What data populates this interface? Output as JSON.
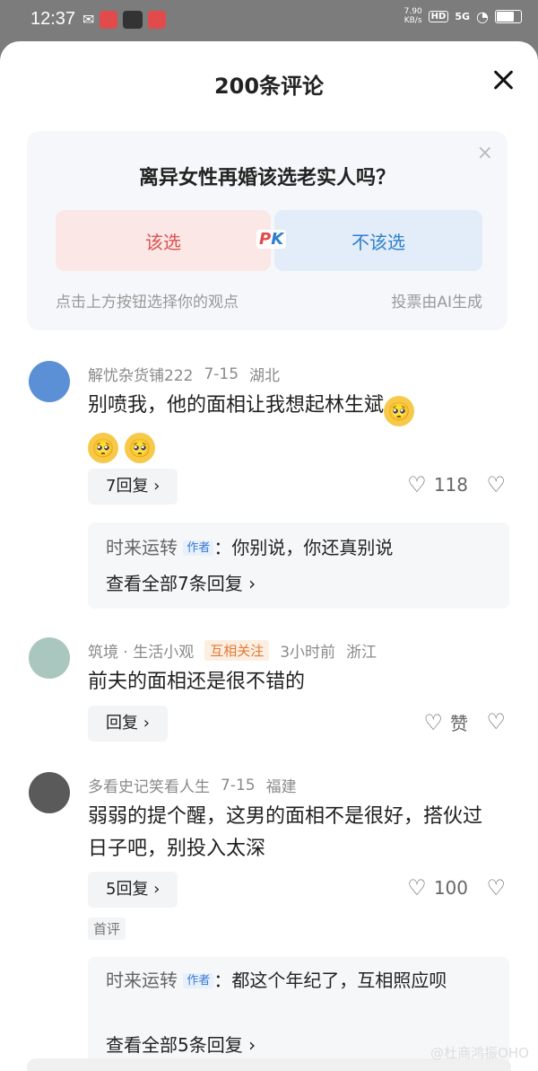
{
  "status": {
    "time": "12:37",
    "speed_value": "7.90",
    "speed_unit": "KB/s",
    "hd": "HD",
    "signal": "5G"
  },
  "sheet": {
    "title": "200条评论"
  },
  "poll": {
    "question": "离异女性再婚该选老实人吗？",
    "option_yes": "该选",
    "option_no": "不该选",
    "pk_p": "P",
    "pk_k": "K",
    "hint_left": "点击上方按钮选择你的观点",
    "hint_right": "投票由AI生成"
  },
  "comments": [
    {
      "user": "解忧杂货铺222",
      "date": "7-15",
      "region": "湖北",
      "text": "别喷我，他的面相让我想起林生斌",
      "reply_label": "7回复 ›",
      "likes": "118",
      "sub_name": "时来运转",
      "sub_author_tag": "作者",
      "sub_text": "：你别说，你还真别说",
      "sub_more": "查看全部7条回复 ›"
    },
    {
      "user": "筑境 · 生活小观",
      "follow_tag": "互相关注",
      "date": "3小时前",
      "region": "浙江",
      "text": "前夫的面相还是很不错的",
      "reply_label": "回复 ›",
      "likes": "赞"
    },
    {
      "user": "多看史记笑看人生",
      "date": "7-15",
      "region": "福建",
      "text": "弱弱的提个醒，这男的面相不是很好，搭伙过日子吧，别投入太深",
      "reply_label": "5回复 ›",
      "likes": "100",
      "first_tag": "首评",
      "sub_name": "时来运转",
      "sub_author_tag": "作者",
      "sub_text": "：都这个年纪了，互相照应呗",
      "sub_more": "查看全部5条回复 ›"
    }
  ],
  "watermark": "@杜商鸿振OHO",
  "colors": {
    "yes_bg": "#fbe7e6",
    "yes_text": "#d9544f",
    "no_bg": "#e2edf9",
    "no_text": "#2f7fcc",
    "follow_tag": "#e07b36"
  }
}
